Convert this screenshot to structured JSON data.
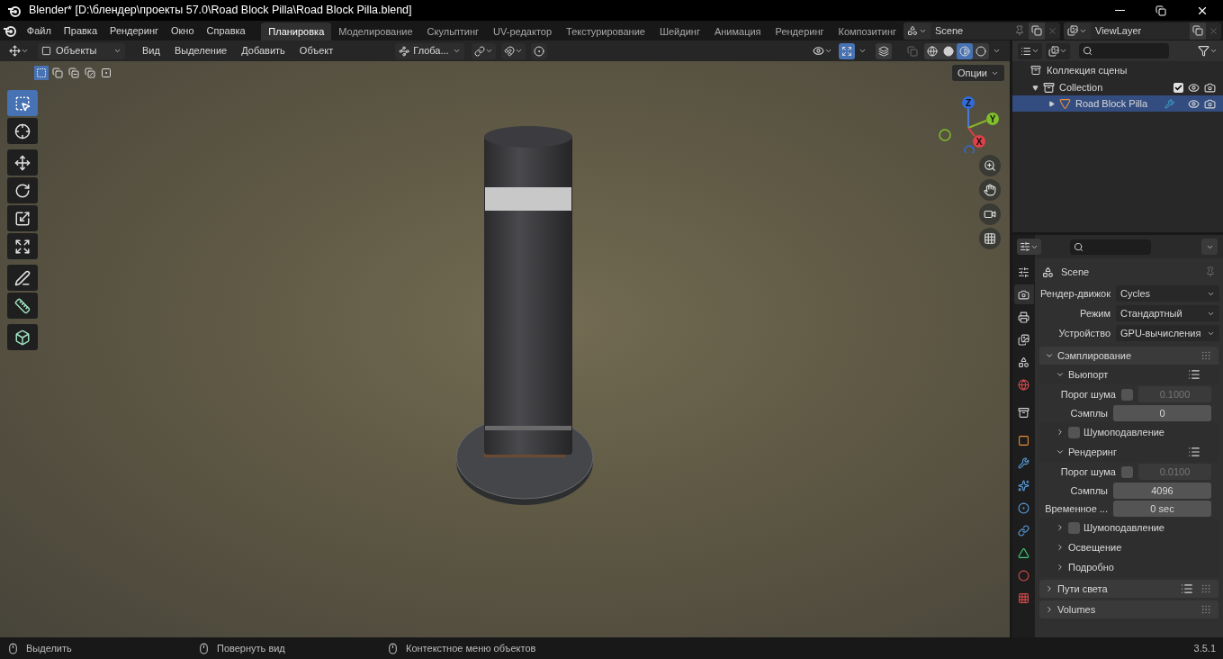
{
  "window": {
    "title": "Blender* [D:\\блендер\\проекты 57.0\\Road Block Pilla\\Road Block Pilla.blend]"
  },
  "menu": [
    "Файл",
    "Правка",
    "Рендеринг",
    "Окно",
    "Справка"
  ],
  "workspaces": [
    {
      "label": "Планировка",
      "selected": true
    },
    {
      "label": "Моделирование",
      "selected": false
    },
    {
      "label": "Скульптинг",
      "selected": false
    },
    {
      "label": "UV-редактор",
      "selected": false
    },
    {
      "label": "Текстурирование",
      "selected": false
    },
    {
      "label": "Шейдинг",
      "selected": false
    },
    {
      "label": "Анимация",
      "selected": false
    },
    {
      "label": "Рендеринг",
      "selected": false
    },
    {
      "label": "Композитинг",
      "selected": false
    }
  ],
  "scene": "Scene",
  "view_layer": "ViewLayer",
  "viewport": {
    "mode": "Объекты",
    "menus": [
      "Вид",
      "Выделение",
      "Добавить",
      "Объект"
    ],
    "orientation": "Глоба...",
    "options": "Опции",
    "select_modes": [
      {
        "kind": "new",
        "selected": true
      },
      {
        "kind": "extend",
        "selected": false
      },
      {
        "kind": "subtract",
        "selected": false
      },
      {
        "kind": "invert",
        "selected": false
      },
      {
        "kind": "intersect",
        "selected": false
      }
    ],
    "shading": [
      {
        "kind": "wireframe",
        "selected": false
      },
      {
        "kind": "solid",
        "selected": false
      },
      {
        "kind": "material",
        "selected": true
      },
      {
        "kind": "rendered",
        "selected": false
      }
    ],
    "tools": [
      {
        "kind": "select",
        "selected": true
      },
      {
        "kind": "cursor",
        "selected": false
      },
      {
        "kind": "move",
        "selected": false
      },
      {
        "kind": "rotate",
        "selected": false
      },
      {
        "kind": "scale",
        "selected": false
      },
      {
        "kind": "transform",
        "selected": false
      },
      {
        "kind": "annotate",
        "selected": false
      },
      {
        "kind": "measure",
        "selected": false
      },
      {
        "kind": "add_cube",
        "selected": false
      }
    ],
    "axes": [
      "Z",
      "Y",
      "X"
    ]
  },
  "outliner": {
    "root": "Коллекция сцены",
    "items": [
      {
        "label": "Collection",
        "expanded": true,
        "checked": true,
        "children": [
          {
            "label": "Road Block Pilla",
            "expanded": false,
            "selected": true
          }
        ]
      }
    ]
  },
  "properties": {
    "context": "Scene",
    "tabs": [
      {
        "kind": "tool",
        "selected": false
      },
      {
        "kind": "render",
        "selected": true
      },
      {
        "kind": "output",
        "selected": false
      },
      {
        "kind": "view_layer",
        "selected": false
      },
      {
        "kind": "scene",
        "selected": false
      },
      {
        "kind": "world",
        "selected": false
      },
      {
        "kind": "collection",
        "selected": false
      },
      {
        "kind": "object",
        "selected": false
      },
      {
        "kind": "modifiers",
        "selected": false
      },
      {
        "kind": "particles",
        "selected": false
      },
      {
        "kind": "physics",
        "selected": false
      },
      {
        "kind": "constraints",
        "selected": false
      },
      {
        "kind": "data",
        "selected": false
      },
      {
        "kind": "material",
        "selected": false
      },
      {
        "kind": "texture",
        "selected": false
      }
    ],
    "settings": [
      {
        "label": "Рендер-движок",
        "value": "Cycles"
      },
      {
        "label": "Режим",
        "value": "Стандартный"
      },
      {
        "label": "Устройство",
        "value": "GPU-вычисления"
      }
    ],
    "panels": [
      {
        "title": "Сэмплирование",
        "expanded": true,
        "presets": false,
        "children": [
          {
            "kind": "subpanel",
            "title": "Вьюпорт",
            "expanded": true,
            "presets": true
          },
          {
            "kind": "threshold",
            "label": "Порог шума",
            "checked": false,
            "value": "0.1000"
          },
          {
            "kind": "number",
            "label": "Сэмплы",
            "value": "0"
          },
          {
            "kind": "subpanel",
            "title": "Шумоподавление",
            "expanded": false,
            "presets": false,
            "checked": false
          },
          {
            "kind": "subpanel",
            "title": "Рендеринг",
            "expanded": true,
            "presets": true
          },
          {
            "kind": "threshold",
            "label": "Порог шума",
            "checked": false,
            "value": "0.0100"
          },
          {
            "kind": "number",
            "label": "Сэмплы",
            "value": "4096"
          },
          {
            "kind": "number",
            "label": "Временное ...",
            "value": "0 sec"
          },
          {
            "kind": "subpanel",
            "title": "Шумоподавление",
            "expanded": false,
            "presets": false,
            "checked": false
          },
          {
            "kind": "subpanel",
            "title": "Освещение",
            "expanded": false,
            "presets": false
          },
          {
            "kind": "subpanel",
            "title": "Подробно",
            "expanded": false,
            "presets": false
          }
        ]
      },
      {
        "title": "Пути света",
        "expanded": false,
        "presets": true
      },
      {
        "title": "Volumes",
        "expanded": false,
        "presets": false
      }
    ]
  },
  "status_bar": {
    "hints": [
      "Выделить",
      "Повернуть вид",
      "Контекстное меню объектов"
    ],
    "version": "3.5.1"
  }
}
